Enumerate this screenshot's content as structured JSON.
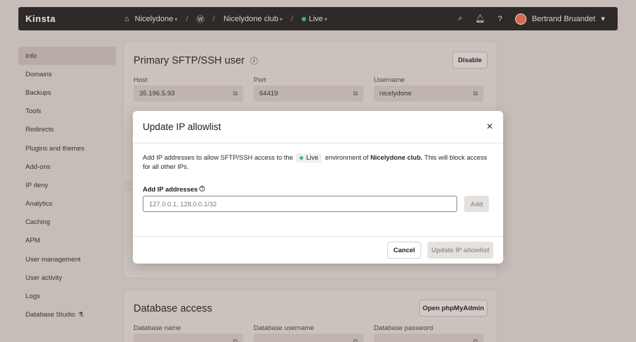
{
  "topbar": {
    "logo": "Kinsta",
    "crumb1": "Nicelydone",
    "crumb2": "Nicelydone club",
    "crumb3": "Live",
    "user_name": "Bertrand Bruandet"
  },
  "sidebar": {
    "items": [
      {
        "label": "Info"
      },
      {
        "label": "Domains"
      },
      {
        "label": "Backups"
      },
      {
        "label": "Tools"
      },
      {
        "label": "Redirects"
      },
      {
        "label": "Plugins and themes"
      },
      {
        "label": "Add-ons"
      },
      {
        "label": "IP deny"
      },
      {
        "label": "Analytics"
      },
      {
        "label": "Caching"
      },
      {
        "label": "APM"
      },
      {
        "label": "User management"
      },
      {
        "label": "User activity"
      },
      {
        "label": "Logs"
      },
      {
        "label": "Database Studio"
      }
    ]
  },
  "sftp": {
    "title": "Primary SFTP/SSH user",
    "disable_label": "Disable",
    "host_label": "Host",
    "host_value": "35.196.5.93",
    "port_label": "Port",
    "port_value": "64419",
    "username_label": "Username",
    "username_value": "nicelydone"
  },
  "database": {
    "title": "Database access",
    "open_label": "Open phpMyAdmin",
    "name_label": "Database name",
    "username_label": "Database username",
    "password_label": "Database password"
  },
  "modal": {
    "title": "Update IP allowlist",
    "desc_part1": "Add IP addresses to allow SFTP/SSH access to the",
    "env_name": "Live",
    "desc_part2": "environment of",
    "site_name": "Nicelydone club.",
    "desc_part3": "This will block access for all other IPs.",
    "field_label": "Add IP addresses",
    "placeholder": "127.0.0.1, 128.0.0.1/32",
    "add_label": "Add",
    "cancel_label": "Cancel",
    "update_label": "Update IP allowlist"
  }
}
